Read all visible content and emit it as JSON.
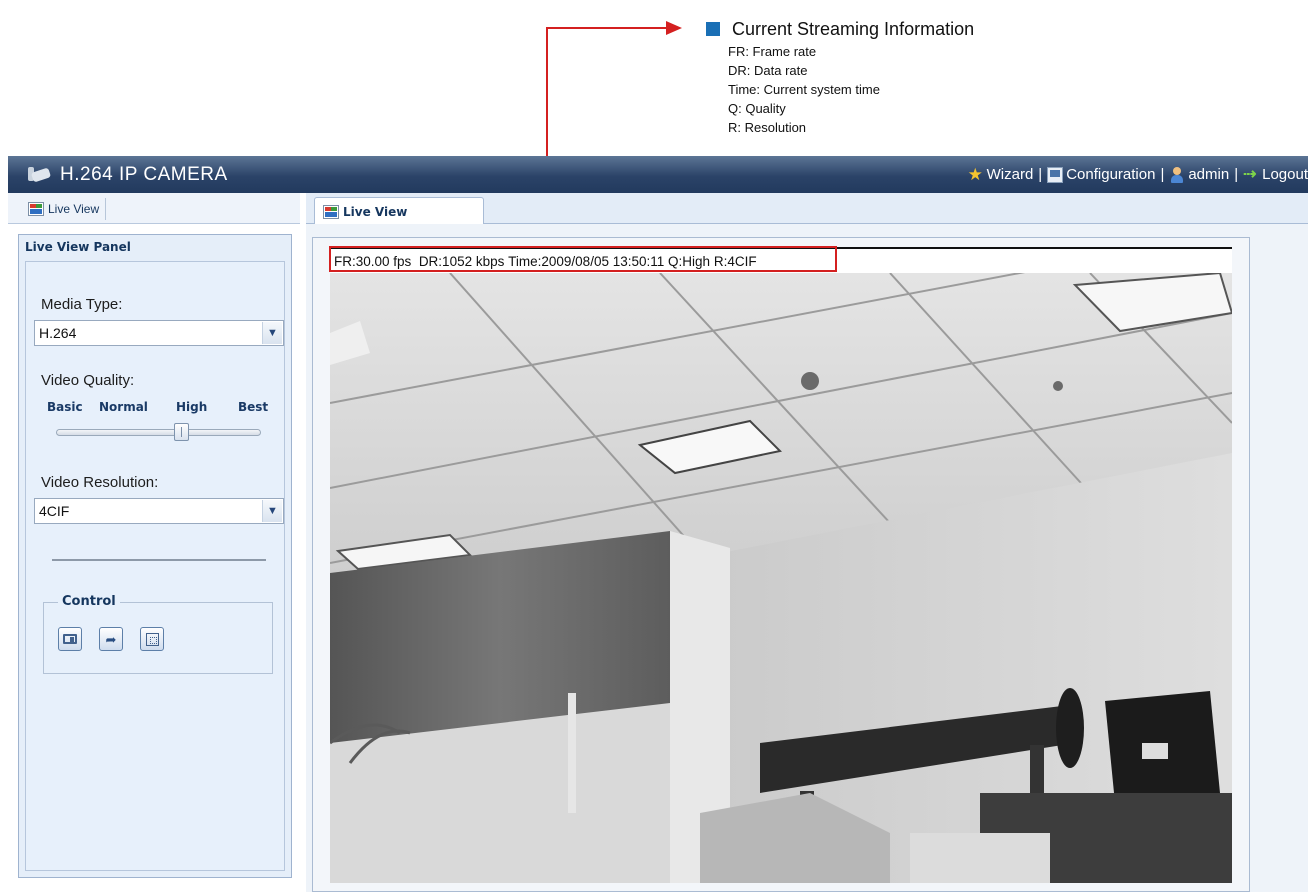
{
  "annotation": {
    "title": "Current Streaming Information",
    "items": [
      "FR: Frame rate",
      "DR: Data rate",
      "Time: Current system time",
      "Q: Quality",
      "R: Resolution"
    ],
    "highlight_color": "#d42020",
    "bullet_color": "#1a6fb5"
  },
  "header": {
    "title": "H.264 IP CAMERA",
    "nav": {
      "wizard": "Wizard",
      "configuration": "Configuration",
      "admin": "admin",
      "logout": "Logout"
    },
    "separator": "|"
  },
  "left_tab": {
    "label": "Live View"
  },
  "left_panel": {
    "header": "Live View Panel",
    "media_type": {
      "label": "Media Type:",
      "value": "H.264"
    },
    "video_quality": {
      "label": "Video Quality:",
      "levels": [
        "Basic",
        "Normal",
        "High",
        "Best"
      ],
      "selected": "High",
      "selected_index": 2
    },
    "video_resolution": {
      "label": "Video Resolution:",
      "value": "4CIF"
    },
    "control": {
      "legend": "Control"
    }
  },
  "main_tab": {
    "label": "Live View"
  },
  "stream_info": {
    "fr": "FR:30.00 fps",
    "dr": "DR:1052 kbps",
    "time": "Time:2009/08/05 13:50:11",
    "q": "Q:High",
    "r": "R:4CIF"
  }
}
